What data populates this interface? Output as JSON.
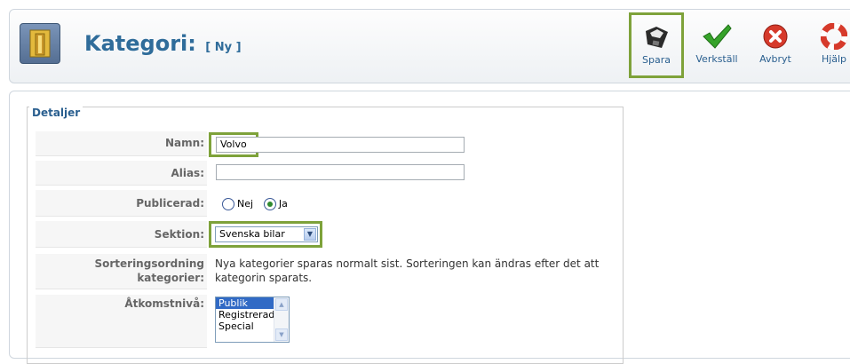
{
  "header": {
    "title": "Kategori:",
    "subtitle": "[ Ny ]",
    "icon": "category-icon"
  },
  "toolbar": {
    "save_label": "Spara",
    "apply_label": "Verkställ",
    "cancel_label": "Avbryt",
    "help_label": "Hjälp"
  },
  "form": {
    "legend": "Detaljer",
    "name_label": "Namn:",
    "name_value": "Volvo",
    "alias_label": "Alias:",
    "alias_value": "",
    "published_label": "Publicerad:",
    "published_no": "Nej",
    "published_yes": "Ja",
    "published_selected": "Ja",
    "section_label": "Sektion:",
    "section_value": "Svenska bilar",
    "ordering_label_1": "Sorteringsordning",
    "ordering_label_2": "kategorier:",
    "ordering_note_1": "Nya kategorier sparas normalt sist. Sorteringen kan ändras efter det att",
    "ordering_note_2": "kategorin sparats.",
    "access_label": "Åtkomstnivå:",
    "access_options": [
      "Publik",
      "Registrerad",
      "Special"
    ],
    "access_selected": "Publik"
  },
  "colors": {
    "accent": "#2f6c9a",
    "highlight": "#7ea23a"
  }
}
